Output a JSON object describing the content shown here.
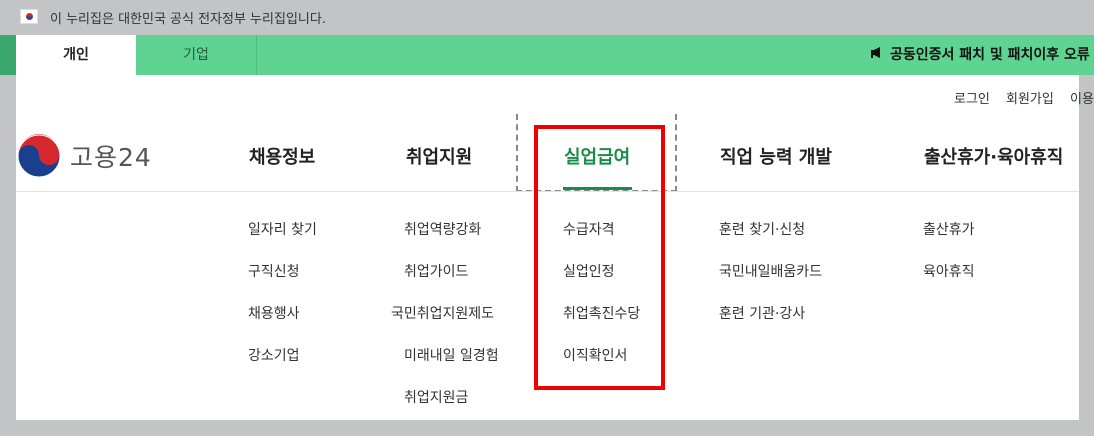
{
  "gov_banner": {
    "text": "이 누리집은 대한민국 공식 전자정부 누리집입니다.",
    "flag_icon": "korea-flag-icon"
  },
  "top_tabs": [
    {
      "label": "개인",
      "active": true
    },
    {
      "label": "기업",
      "active": false
    }
  ],
  "notice": {
    "icon": "megaphone-icon",
    "text": "공동인증서 패치 및 패치이후 오류"
  },
  "util_links": [
    "로그인",
    "회원가입",
    "이용"
  ],
  "logo": {
    "text": "고용24"
  },
  "gnb": [
    "채용정보",
    "취업지원",
    "실업급여",
    "직업 능력 개발",
    "출산휴가·육아휴직"
  ],
  "active_gnb": "실업급여",
  "submenus": {
    "jobs": [
      "일자리 찾기",
      "구직신청",
      "채용행사",
      "강소기업"
    ],
    "support": [
      "취업역량강화",
      "취업가이드",
      "국민취업지원제도",
      "미래내일 일경험",
      "취업지원금"
    ],
    "benefits": [
      "수급자격",
      "실업인정",
      "취업촉진수당",
      "이직확인서"
    ],
    "training": [
      "훈련 찾기·신청",
      "국민내일배움카드",
      "훈련 기관·강사"
    ],
    "leave": [
      "출산휴가",
      "육아휴직"
    ]
  },
  "colors": {
    "green": "#5fd391",
    "active_green": "#1a8c4a",
    "highlight_red": "#ee0000"
  }
}
